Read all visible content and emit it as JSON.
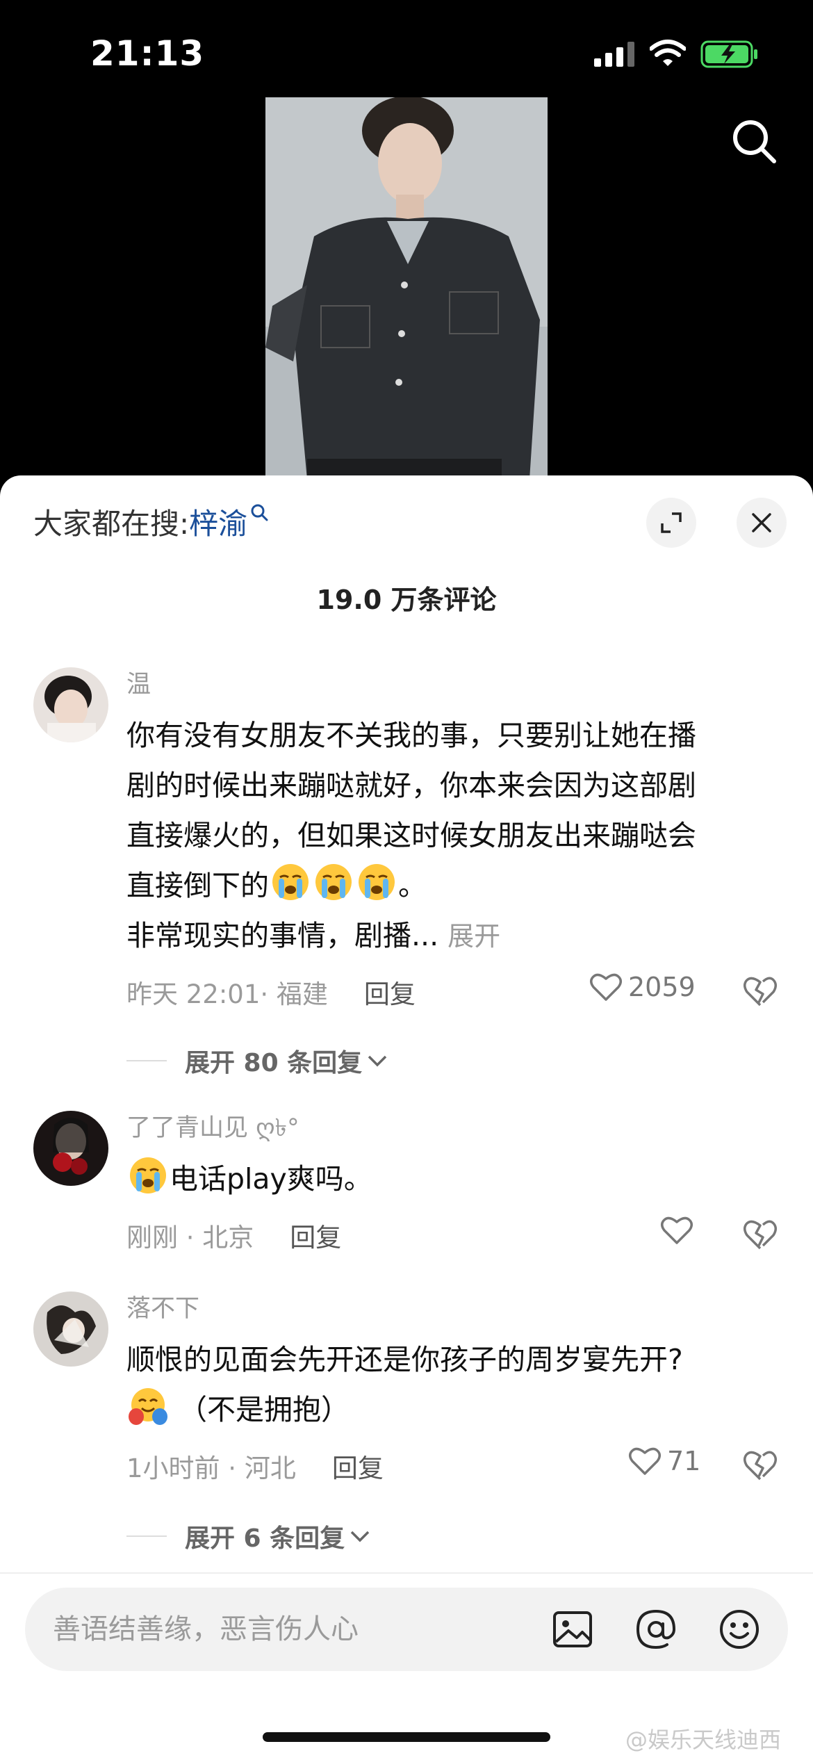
{
  "status_bar": {
    "time": "21:13",
    "battery_color": "#4cd964"
  },
  "sheet": {
    "trending_prefix": "大家都在搜:",
    "trending_keyword": "梓渝",
    "comment_count": "19.0 万条评论"
  },
  "comments": [
    {
      "username": "温",
      "text_lines": [
        "你有没有女朋友不关我的事，只要别让她在播",
        "剧的时候出来蹦哒就好，你本来会因为这部剧",
        "直接爆火的，但如果这时候女朋友出来蹦哒会",
        "直接倒下的"
      ],
      "text_tail": "。",
      "line5": "非常现实的事情，剧播...",
      "more_label": "展开",
      "emoji": "crying-face",
      "meta": "昨天 22:01· 福建",
      "reply_label": "回复",
      "likes": "2059",
      "expand_replies": "展开 80 条回复"
    },
    {
      "username": "了了青山见 ღ৳°",
      "text": "电话play爽吗。",
      "emoji": "crying-face",
      "meta": "刚刚 · 北京",
      "reply_label": "回复",
      "likes": ""
    },
    {
      "username": "落不下",
      "text": "顺恨的见面会先开还是你孩子的周岁宴先开?",
      "text_line2": "（不是拥抱）",
      "emoji": "hugging-face",
      "meta": "1小时前 · 河北",
      "reply_label": "回复",
      "likes": "71",
      "expand_replies": "展开 6 条回复"
    }
  ],
  "input": {
    "placeholder": "善语结善缘，恶言伤人心"
  },
  "watermark": "@娱乐天线迪西"
}
